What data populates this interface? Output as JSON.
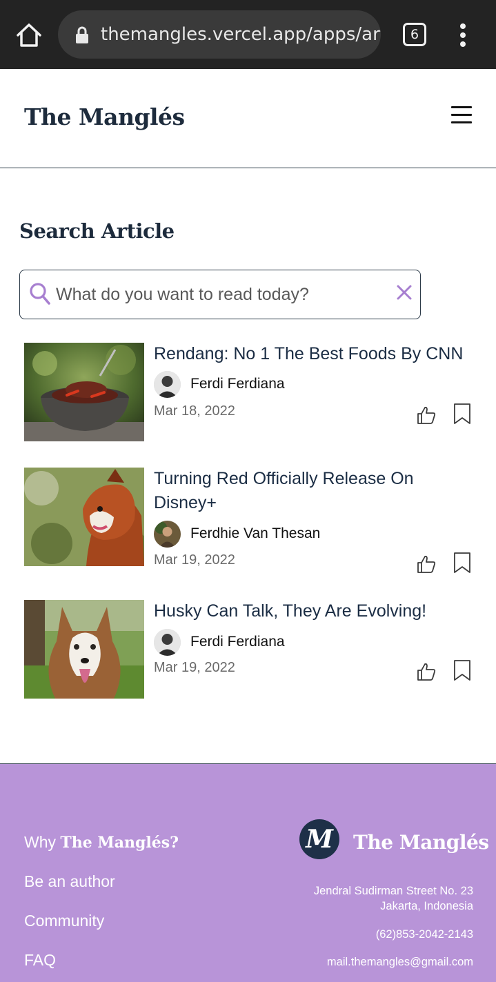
{
  "browser": {
    "url": "themangles.vercel.app/apps/art",
    "tab_count": "6"
  },
  "header": {
    "brand": "The Manglés"
  },
  "search": {
    "title": "Search Article",
    "placeholder": "What do you want to read today?",
    "value": ""
  },
  "articles": [
    {
      "title": "Rendang: No 1 The Best Foods By CNN",
      "author": "Ferdi Ferdiana",
      "date": "Mar 18, 2022"
    },
    {
      "title": "Turning Red Officially Release On Disney+",
      "author": "Ferdhie Van Thesan",
      "date": "Mar 19, 2022"
    },
    {
      "title": "Husky Can Talk, They Are Evolving!",
      "author": "Ferdi Ferdiana",
      "date": "Mar 19, 2022"
    }
  ],
  "footer": {
    "why_prefix": "Why ",
    "why_brand": "The Manglés?",
    "links": [
      "Be an author",
      "Community",
      "FAQ"
    ],
    "logo_letter": "M",
    "brand": "The Manglés",
    "address_line1": "Jendral Sudirman Street No. 23",
    "address_line2": "Jakarta, Indonesia",
    "phone": "(62)853-2042-2143",
    "email": "mail.themangles@gmail.com"
  },
  "colors": {
    "browser_bar": "#232323",
    "brand_navy": "#1d2b3c",
    "accent_lavender": "#b894d8",
    "icon_lavender": "#a77fd0"
  },
  "icons": [
    "home-icon",
    "lock-icon",
    "tab-switcher-icon",
    "more-vert-icon",
    "menu-icon",
    "search-icon",
    "clear-icon",
    "thumbs-up-icon",
    "bookmark-icon"
  ]
}
